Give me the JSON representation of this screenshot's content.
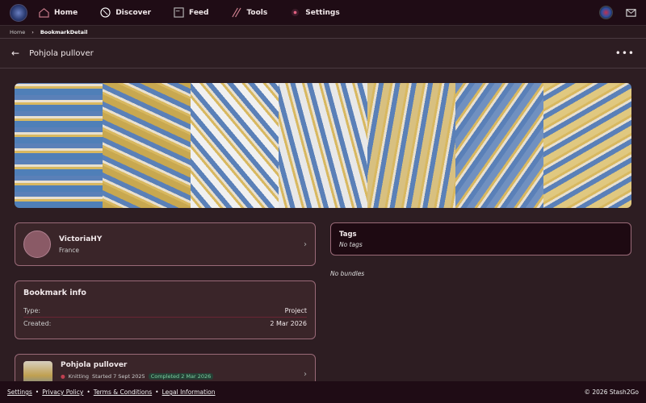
{
  "nav": {
    "items": [
      {
        "label": "Home",
        "icon": "home-icon"
      },
      {
        "label": "Discover",
        "icon": "compass-icon"
      },
      {
        "label": "Feed",
        "icon": "feed-icon"
      },
      {
        "label": "Tools",
        "icon": "needles-icon"
      },
      {
        "label": "Settings",
        "icon": "settings-dot-icon"
      }
    ]
  },
  "breadcrumb": {
    "home": "Home",
    "sep": "›",
    "current": "BookmarkDetail"
  },
  "page": {
    "title": "Pohjola pullover",
    "back": "←",
    "more": "•••"
  },
  "gallery": {
    "count": 7,
    "colors": [
      "#4f7fb8",
      "#c8a850",
      "#f0f0f0",
      "#e8e8e8",
      "#d8c080",
      "#7090c0",
      "#e0c880"
    ]
  },
  "user": {
    "name": "VictoriaHY",
    "country": "France",
    "chevron": "›"
  },
  "bookmark_info": {
    "title": "Bookmark info",
    "type_label": "Type:",
    "type_value": "Project",
    "created_label": "Created:",
    "created_value": "2 Mar 2026"
  },
  "tags": {
    "title": "Tags",
    "value": "No tags"
  },
  "bundles": {
    "value": "No bundles"
  },
  "project": {
    "name": "Pohjola pullover",
    "chips": [
      "Knitting",
      "Started 7 Sept 2025",
      "Completed 2 Mar 2026"
    ],
    "chevron": "›"
  },
  "footer": {
    "links": [
      "Settings",
      "Privacy Policy",
      "Terms & Conditions",
      "Legal Information"
    ],
    "copyright": "© 2026 Stash2Go"
  },
  "colors": {
    "nav_bg": "#1f0c15",
    "card_border": "#9a6a78",
    "completed": "#7ad0a0"
  }
}
